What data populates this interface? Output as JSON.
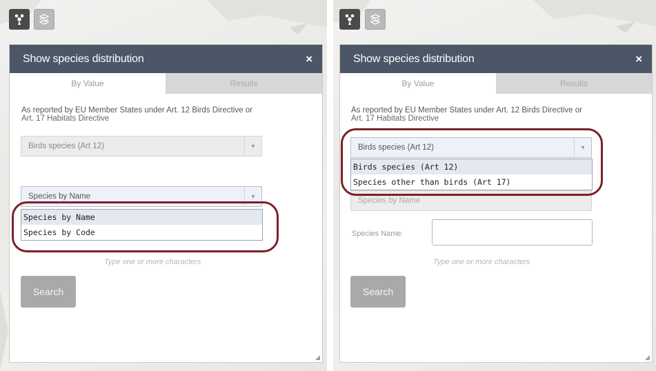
{
  "left": {
    "panel_title": "Show species distribution",
    "close_symbol": "×",
    "tabs": [
      "By Value",
      "Results"
    ],
    "description_line1": "As reported by EU Member States under Art. 12 Birds Directive or",
    "description_line2": "Art. 17 Habitats Directive",
    "group_select": {
      "value": "Birds species (Art 12)",
      "arrow": "▾"
    },
    "search_by_select": {
      "value": "Species by Name",
      "arrow": "▾"
    },
    "search_by_options": [
      "Species by Name",
      "Species by Code"
    ],
    "hint": "Type one or more characters",
    "search_label": "Search",
    "resize_glyph": "◢"
  },
  "right": {
    "panel_title": "Show species distribution",
    "close_symbol": "×",
    "tabs": [
      "By Value",
      "Results"
    ],
    "description_line1": "As reported by EU Member States under Art. 12 Birds Directive or",
    "description_line2": "Art. 17 Habitats Directive",
    "group_select": {
      "value": "Birds species (Art 12)",
      "arrow": "▾"
    },
    "group_options": [
      "Birds species (Art 12)",
      "Species other than birds (Art 17)"
    ],
    "search_by_partial": "Species by Name",
    "species_name_label": "Species Name:",
    "species_name_value": "",
    "hint": "Type one or more characters",
    "search_label": "Search",
    "resize_glyph": "◢"
  },
  "icons": {
    "tool1": "species-distribution-icon",
    "tool2": "layers-icon"
  },
  "colors": {
    "header": "#4b5667",
    "highlight_ring": "#7d1f2b",
    "search_button": "#a9a9a9"
  }
}
